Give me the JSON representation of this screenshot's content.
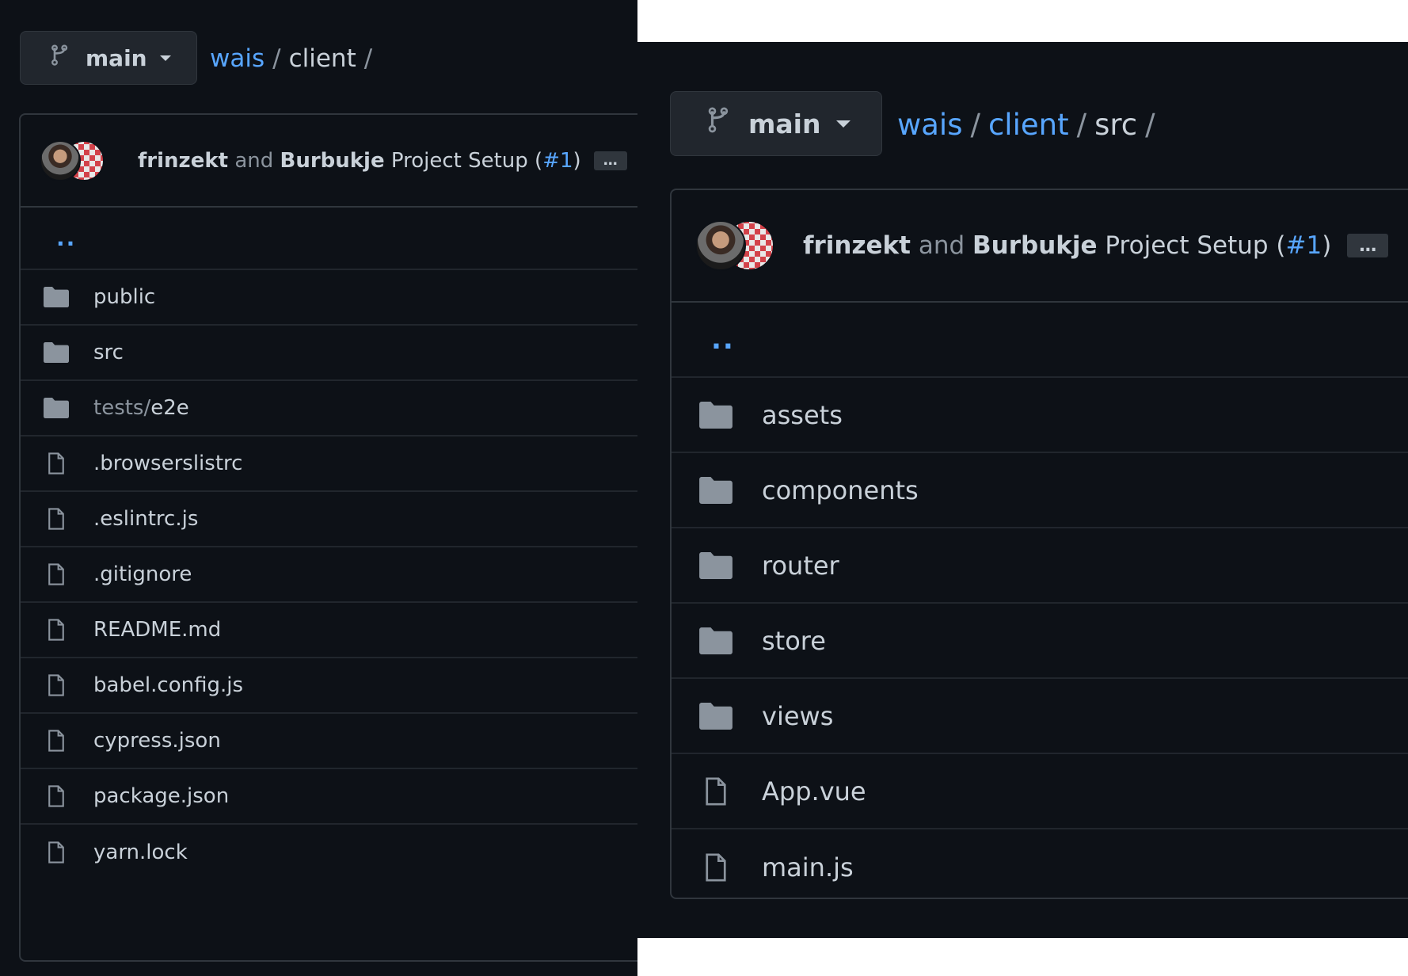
{
  "left": {
    "branch": "main",
    "breadcrumb": {
      "repo": "wais",
      "sep1": "/",
      "current": "client",
      "sep2": "/"
    },
    "commit": {
      "author1": "frinzekt",
      "and": "and",
      "author2": "Burbukje",
      "message": "Project Setup",
      "open_paren": "(",
      "pr": "#1",
      "close_paren": ")",
      "ellipsis": "…"
    },
    "parent_link": "..",
    "files": [
      {
        "type": "folder",
        "name": "public"
      },
      {
        "type": "folder",
        "name": "src"
      },
      {
        "type": "folder",
        "prefix": "tests/",
        "name": "e2e"
      },
      {
        "type": "file",
        "name": ".browserslistrc"
      },
      {
        "type": "file",
        "name": ".eslintrc.js"
      },
      {
        "type": "file",
        "name": ".gitignore"
      },
      {
        "type": "file",
        "name": "README.md"
      },
      {
        "type": "file",
        "name": "babel.config.js"
      },
      {
        "type": "file",
        "name": "cypress.json"
      },
      {
        "type": "file",
        "name": "package.json"
      },
      {
        "type": "file",
        "name": "yarn.lock"
      }
    ]
  },
  "right": {
    "branch": "main",
    "breadcrumb": {
      "repo": "wais",
      "sep1": "/",
      "mid": "client",
      "sep2": "/",
      "current": "src",
      "sep3": "/"
    },
    "commit": {
      "author1": "frinzekt",
      "and": "and",
      "author2": "Burbukje",
      "message": "Project Setup",
      "open_paren": "(",
      "pr": "#1",
      "close_paren": ")",
      "ellipsis": "…"
    },
    "parent_link": "..",
    "files": [
      {
        "type": "folder",
        "name": "assets"
      },
      {
        "type": "folder",
        "name": "components"
      },
      {
        "type": "folder",
        "name": "router"
      },
      {
        "type": "folder",
        "name": "store"
      },
      {
        "type": "folder",
        "name": "views"
      },
      {
        "type": "file",
        "name": "App.vue"
      },
      {
        "type": "file",
        "name": "main.js"
      }
    ]
  },
  "colors": {
    "bg": "#0d1117",
    "border": "#30363d",
    "link": "#58a6ff",
    "text": "#c9d1d9",
    "muted": "#8b949e",
    "icon": "#8b949e"
  },
  "icons": {
    "branch": "git-branch-icon",
    "folder": "folder-icon",
    "file": "file-icon",
    "caret": "caret-down-icon"
  }
}
